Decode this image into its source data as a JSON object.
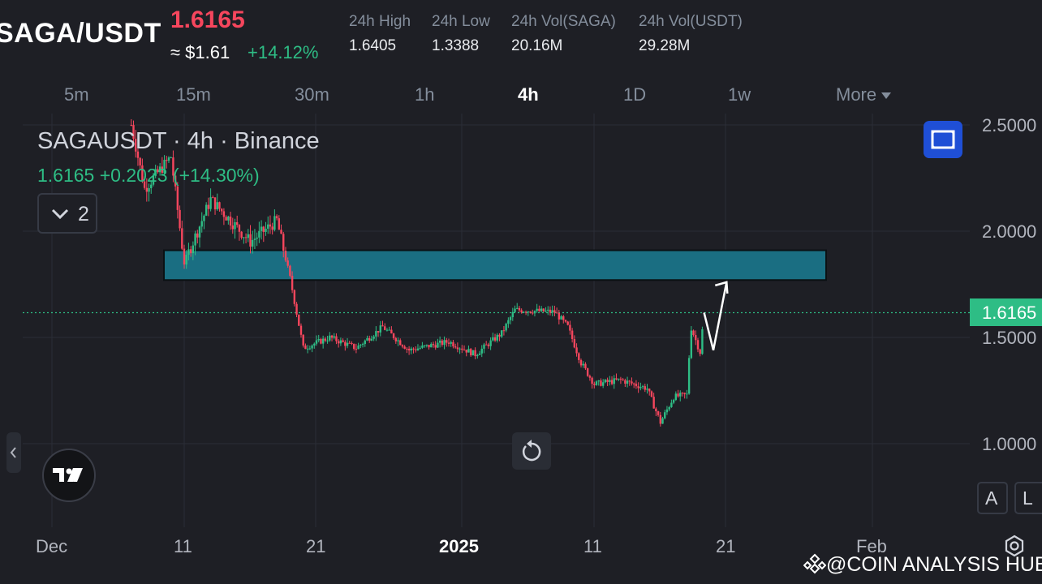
{
  "header": {
    "pair": "SAGA/USDT",
    "last_price": "1.6165",
    "approx_usd": "≈ $1.61",
    "change_pct": "+14.12%",
    "stats": [
      {
        "label": "24h High",
        "value": "1.6405"
      },
      {
        "label": "24h Low",
        "value": "1.3388"
      },
      {
        "label": "24h Vol(SAGA)",
        "value": "20.16M"
      },
      {
        "label": "24h Vol(USDT)",
        "value": "29.28M"
      }
    ]
  },
  "intervals": {
    "items": [
      "5m",
      "15m",
      "30m",
      "1h",
      "4h",
      "1D",
      "1w",
      "More"
    ],
    "active": "4h"
  },
  "chart": {
    "legend_title": "SAGAUSDT · 4h · Binance",
    "legend_ohlc": "1.6165 +0.2023 (+14.30%)",
    "collapse_count": "2",
    "price_axis": [
      "2.5000",
      "2.0000",
      "1.5000",
      "1.0000"
    ],
    "current_price": "1.6165",
    "time_axis": [
      "Dec",
      "11",
      "21",
      "2025",
      "11",
      "21",
      "Feb"
    ],
    "zone": {
      "low": 1.77,
      "high": 1.91
    },
    "bottom_buttons": {
      "a": "A",
      "l": "L"
    }
  },
  "chart_data": {
    "type": "candlestick",
    "title": "SAGAUSDT · 4h · Binance",
    "ylim": [
      0.98,
      2.55
    ],
    "x_ticks": [
      "Dec",
      "11",
      "21",
      "2025",
      "11",
      "21",
      "Feb"
    ],
    "y_ticks": [
      2.5,
      2.0,
      1.5,
      1.0
    ],
    "last_price": 1.6165,
    "anchors": [
      {
        "date": "Dec 7",
        "price": 2.5
      },
      {
        "date": "Dec 8",
        "price": 2.2
      },
      {
        "date": "Dec 10",
        "price": 2.35
      },
      {
        "date": "Dec 11",
        "price": 1.85
      },
      {
        "date": "Dec 13",
        "price": 2.15
      },
      {
        "date": "Dec 16",
        "price": 1.95
      },
      {
        "date": "Dec 18",
        "price": 2.05
      },
      {
        "date": "Dec 19",
        "price": 1.78
      },
      {
        "date": "Dec 20",
        "price": 1.45
      },
      {
        "date": "Dec 22",
        "price": 1.5
      },
      {
        "date": "Dec 24",
        "price": 1.45
      },
      {
        "date": "Dec 26",
        "price": 1.55
      },
      {
        "date": "Dec 28",
        "price": 1.44
      },
      {
        "date": "Dec 31",
        "price": 1.48
      },
      {
        "date": "Jan 2",
        "price": 1.42
      },
      {
        "date": "Jan 4",
        "price": 1.52
      },
      {
        "date": "Jan 5",
        "price": 1.63
      },
      {
        "date": "Jan 8",
        "price": 1.62
      },
      {
        "date": "Jan 9",
        "price": 1.55
      },
      {
        "date": "Jan 10",
        "price": 1.38
      },
      {
        "date": "Jan 11",
        "price": 1.28
      },
      {
        "date": "Jan 13",
        "price": 1.3
      },
      {
        "date": "Jan 15",
        "price": 1.26
      },
      {
        "date": "Jan 16",
        "price": 1.1
      },
      {
        "date": "Jan 17",
        "price": 1.22
      },
      {
        "date": "Jan 18",
        "price": 1.23
      },
      {
        "date": "Jan 18.3",
        "price": 1.55
      },
      {
        "date": "Jan 19",
        "price": 1.43
      },
      {
        "date": "Jan 19.3",
        "price": 1.6165
      }
    ],
    "projection": [
      {
        "date": "Jan 19.3",
        "price": 1.6165
      },
      {
        "date": "Jan 20",
        "price": 1.44
      },
      {
        "date": "Jan 21",
        "price": 1.76
      }
    ]
  },
  "colors": {
    "background": "#1e1f25",
    "up": "#2ebd85",
    "down": "#f6465d",
    "zone_fill": "#1a6e82",
    "accent": "#1f4fd6"
  },
  "footer": {
    "watermark": "@COIN ANALYSIS HUB"
  }
}
